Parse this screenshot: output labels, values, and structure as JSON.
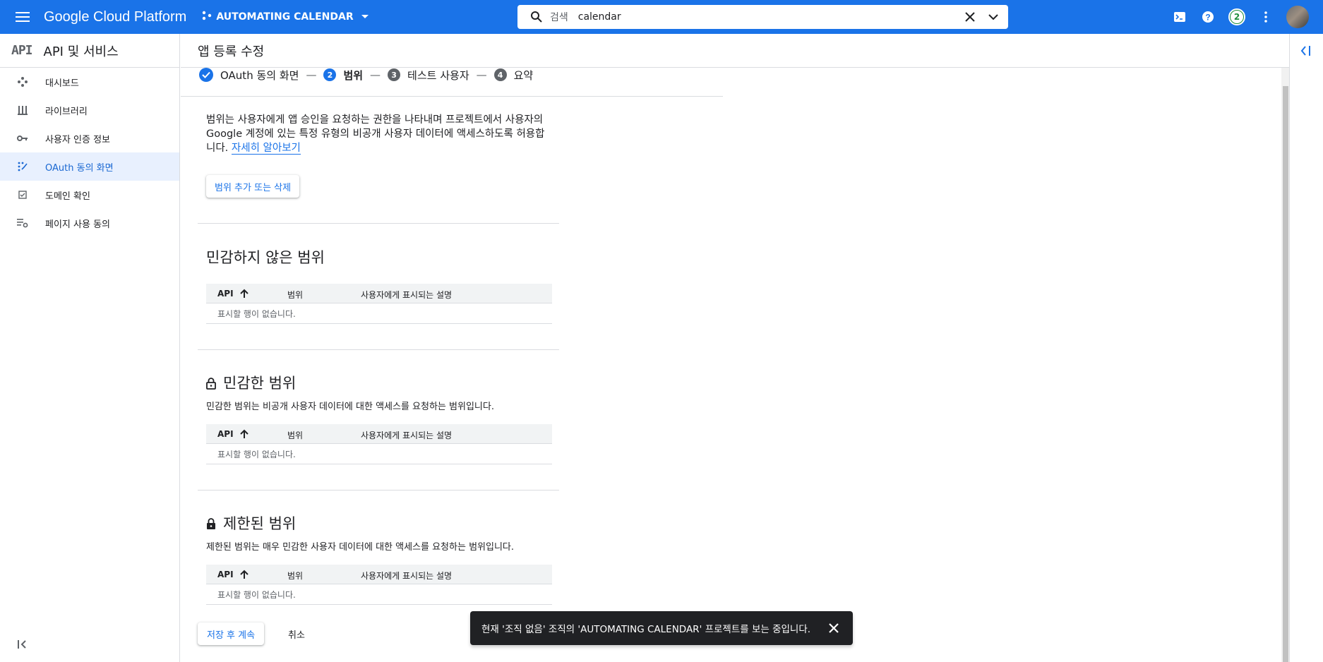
{
  "topbar": {
    "brand": "Google Cloud Platform",
    "project": "AUTOMATING CALENDAR",
    "search_label": "검색",
    "search_query": "calendar",
    "notification_count": "2"
  },
  "sidebar": {
    "logo": "API",
    "title": "API 및 서비스",
    "items": [
      {
        "label": "대시보드",
        "icon": "dashboard-icon"
      },
      {
        "label": "라이브러리",
        "icon": "library-icon"
      },
      {
        "label": "사용자 인증 정보",
        "icon": "key-icon"
      },
      {
        "label": "OAuth 동의 화면",
        "icon": "oauth-consent-icon",
        "active": true
      },
      {
        "label": "도메인 확인",
        "icon": "domain-check-icon"
      },
      {
        "label": "페이지 사용 동의",
        "icon": "page-settings-icon"
      }
    ]
  },
  "header": {
    "title": "앱 등록 수정"
  },
  "stepper": {
    "steps": [
      {
        "number": "1",
        "label": "OAuth 동의 화면",
        "state": "done"
      },
      {
        "number": "2",
        "label": "범위",
        "state": "active"
      },
      {
        "number": "3",
        "label": "테스트 사용자",
        "state": "todo"
      },
      {
        "number": "4",
        "label": "요약",
        "state": "todo"
      }
    ],
    "separator": "—"
  },
  "intro": {
    "text": "범위는 사용자에게 앱 승인을 요청하는 권한을 나타내며 프로젝트에서 사용자의 Google 계정에 있는 특정 유형의 비공개 사용자 데이터에 액세스하도록 허용합니다. ",
    "link": "자세히 알아보기"
  },
  "add_scope_button": "범위 추가 또는 삭제",
  "table_headers": {
    "api": "API",
    "scope": "범위",
    "desc": "사용자에게 표시되는 설명"
  },
  "empty_row": "표시할 행이 없습니다.",
  "sections": {
    "non_sensitive": {
      "title": "민감하지 않은 범위"
    },
    "sensitive": {
      "title": "민감한 범위",
      "desc": "민감한 범위는 비공개 사용자 데이터에 대한 액세스를 요청하는 범위입니다."
    },
    "restricted": {
      "title": "제한된 범위",
      "desc": "제한된 범위는 매우 민감한 사용자 데이터에 대한 액세스를 요청하는 범위입니다."
    }
  },
  "actions": {
    "save": "저장 후 계속",
    "cancel": "취소"
  },
  "snackbar": {
    "message": "현재 '조직 없음' 조직의 'AUTOMATING CALENDAR' 프로젝트를 보는 중입니다."
  },
  "colors": {
    "primary": "#1a73e8",
    "active_bg": "#e8f0fe",
    "snackbar_bg": "#202124",
    "badge": "#1e8e3e"
  }
}
